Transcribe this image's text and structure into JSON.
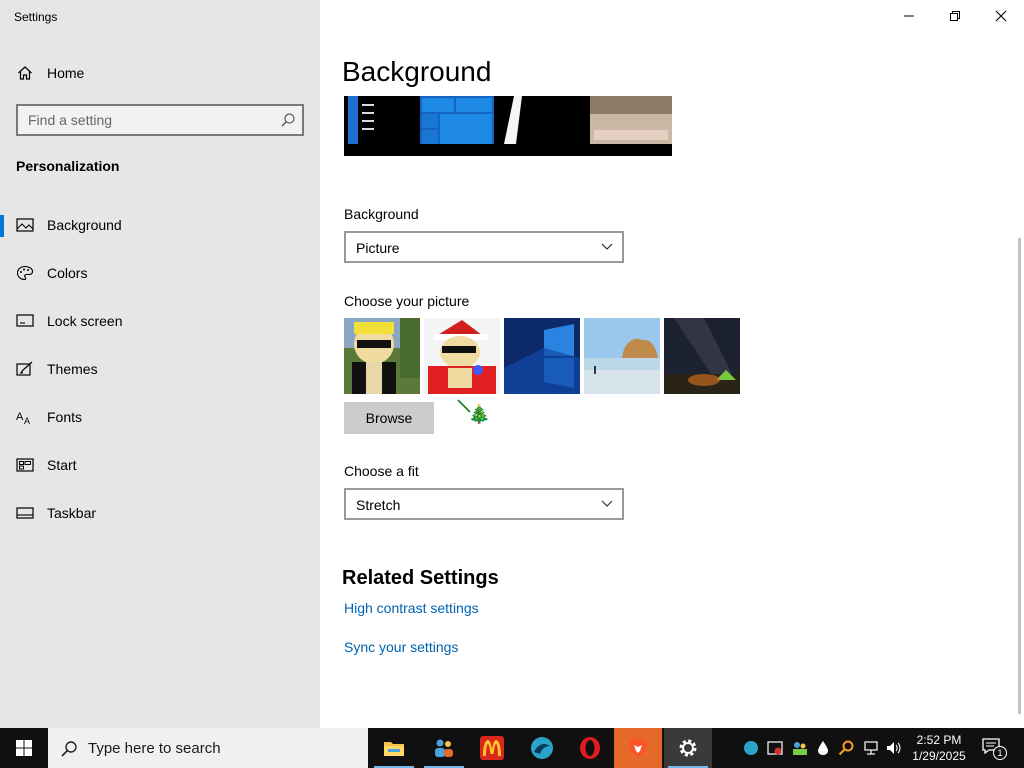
{
  "window": {
    "title": "Settings"
  },
  "sidebar": {
    "home_label": "Home",
    "search_placeholder": "Find a setting",
    "section_heading": "Personalization",
    "items": [
      {
        "label": "Background",
        "icon": "picture-icon",
        "selected": true
      },
      {
        "label": "Colors",
        "icon": "palette-icon"
      },
      {
        "label": "Lock screen",
        "icon": "lock-screen-icon"
      },
      {
        "label": "Themes",
        "icon": "themes-icon"
      },
      {
        "label": "Fonts",
        "icon": "fonts-icon"
      },
      {
        "label": "Start",
        "icon": "start-icon"
      },
      {
        "label": "Taskbar",
        "icon": "taskbar-icon"
      }
    ]
  },
  "main": {
    "title": "Background",
    "background_label": "Background",
    "background_value": "Picture",
    "choose_picture_label": "Choose your picture",
    "pictures": [
      {
        "name": "cartoon-sunglasses-1"
      },
      {
        "name": "cartoon-santa-hat"
      },
      {
        "name": "windows-10-blue"
      },
      {
        "name": "beach-rock-arch"
      },
      {
        "name": "night-sky-tent"
      }
    ],
    "browse_label": "Browse",
    "tree_emoji": "🎄",
    "fit_label": "Choose a fit",
    "fit_value": "Stretch",
    "related_heading": "Related Settings",
    "links": [
      "High contrast settings",
      "Sync your settings"
    ]
  },
  "taskbar": {
    "search_placeholder": "Type here to search",
    "apps": [
      "file-explorer",
      "people-app",
      "mcdonalds",
      "edge-dev",
      "opera",
      "brave",
      "settings"
    ],
    "clock_time": "2:52 PM",
    "clock_date": "1/29/2025",
    "notification_count": "1"
  },
  "colors": {
    "accent": "#0078d7",
    "link": "#0063b1",
    "sidebar_bg": "#e6e6e6",
    "taskbar_bg": "#101010"
  }
}
